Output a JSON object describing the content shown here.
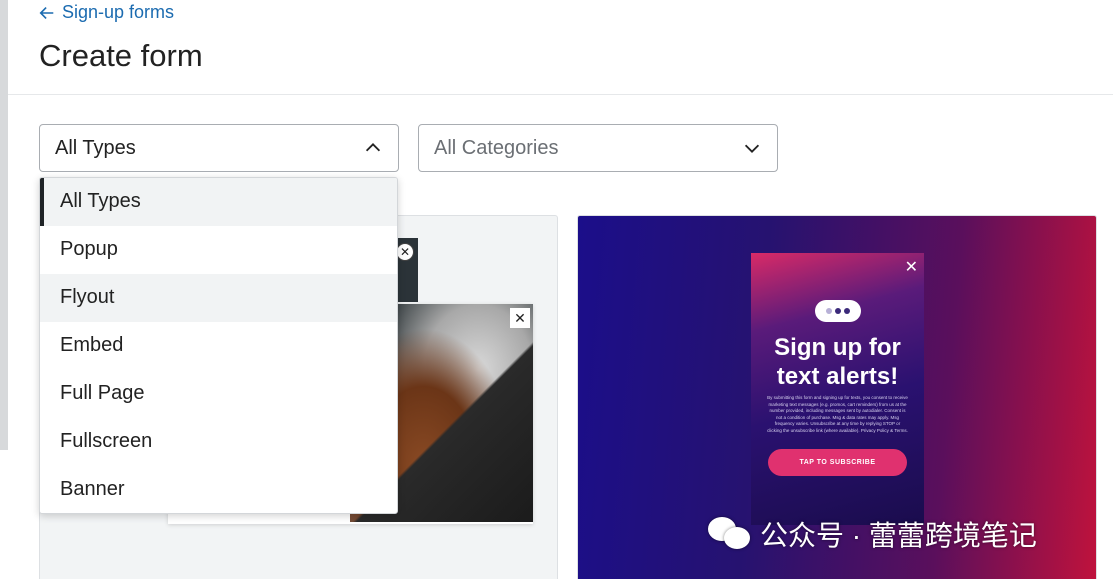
{
  "header": {
    "back_label": "Sign-up forms",
    "title": "Create form"
  },
  "filters": {
    "types": {
      "value": "All Types",
      "expanded": true
    },
    "categories": {
      "value": "All Categories",
      "expanded": false
    }
  },
  "dropdown": {
    "options": [
      "All Types",
      "Popup",
      "Flyout",
      "Embed",
      "Full Page",
      "Fullscreen",
      "Banner"
    ],
    "selected_index": 0,
    "hover_index": 2
  },
  "cards": {
    "two": {
      "headline_line1": "Sign up for",
      "headline_line2": "text alerts!",
      "fine_print": "By submitting this form and signing up for texts, you consent to receive marketing text messages (e.g. promos, cart reminders) from us at the number provided, including messages sent by autodialer. Consent is not a condition of purchase. Msg & data rates may apply. Msg frequency varies. Unsubscribe at any time by replying STOP or clicking the unsubscribe link (where available). Privacy Policy & Terms.",
      "cta": "TAP TO SUBSCRIBE"
    }
  },
  "watermark": {
    "text": "公众号 · 蕾蕾跨境笔记"
  },
  "colors": {
    "link": "#1b6bb0",
    "cta": "#e0316f"
  },
  "icons": [
    "arrow-left-icon",
    "chevron-up-icon",
    "chevron-down-icon",
    "close-icon",
    "chat-bubble-icon",
    "wechat-icon"
  ]
}
